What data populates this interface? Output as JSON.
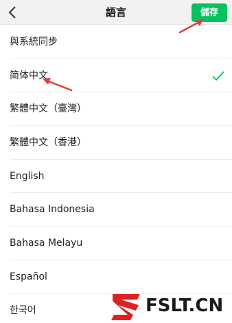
{
  "header": {
    "back_icon": "chevron-left-icon",
    "title": "語言",
    "save_label": "儲存",
    "accent_color": "#07c160"
  },
  "languages": [
    {
      "label": "與系統同步",
      "selected": false
    },
    {
      "label": "简体中文",
      "selected": true
    },
    {
      "label": "繁體中文（臺灣）",
      "selected": false
    },
    {
      "label": "繁體中文（香港）",
      "selected": false
    },
    {
      "label": "English",
      "selected": false
    },
    {
      "label": "Bahasa Indonesia",
      "selected": false
    },
    {
      "label": "Bahasa Melayu",
      "selected": false
    },
    {
      "label": "Español",
      "selected": false
    },
    {
      "label": "한국어",
      "selected": false
    }
  ],
  "check_icon": "check-icon",
  "watermark": {
    "text": "FSLT.CN",
    "logo_color": "#e02020"
  }
}
